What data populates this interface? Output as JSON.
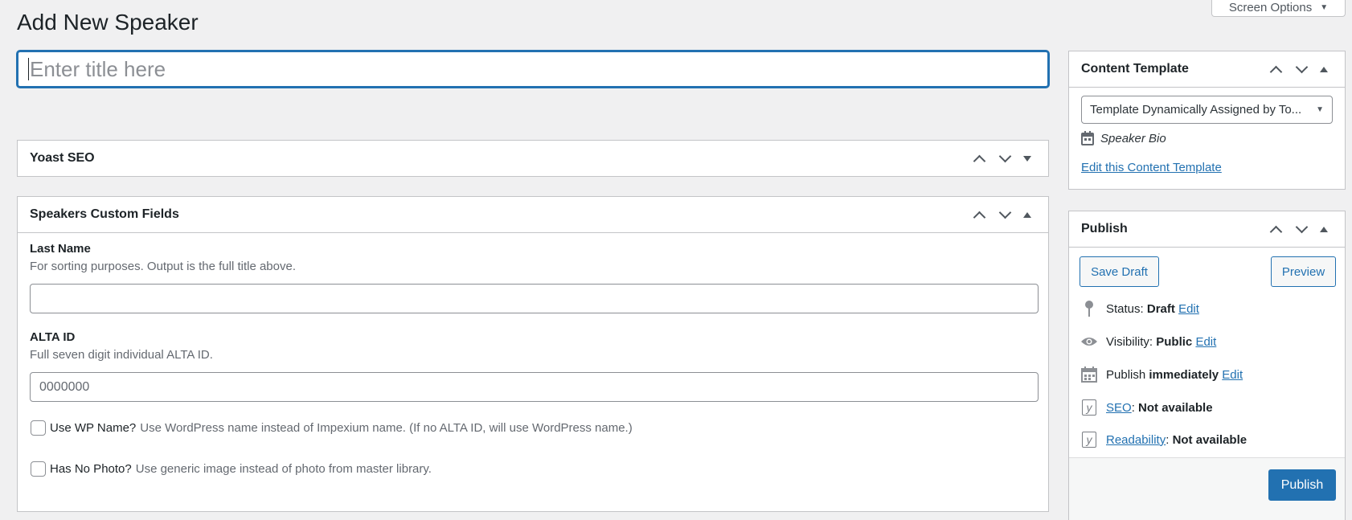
{
  "header": {
    "title": "Add New Speaker",
    "screen_options": "Screen Options"
  },
  "title_input": {
    "placeholder": "Enter title here"
  },
  "yoast_box": {
    "title": "Yoast SEO"
  },
  "custom_fields_box": {
    "title": "Speakers Custom Fields",
    "last_name": {
      "label": "Last Name",
      "description": "For sorting purposes. Output is the full title above.",
      "value": ""
    },
    "alta_id": {
      "label": "ALTA ID",
      "description": "Full seven digit individual ALTA ID.",
      "placeholder": "0000000"
    },
    "use_wp_name": {
      "label": "Use WP Name?",
      "description": "Use WordPress name instead of Impexium name. (If no ALTA ID, will use WordPress name.)"
    },
    "has_no_photo": {
      "label": "Has No Photo?",
      "description": "Use generic image instead of photo from master library."
    }
  },
  "content_template_box": {
    "title": "Content Template",
    "select_value": "Template Dynamically Assigned by To...",
    "template_name": "Speaker Bio",
    "edit_link": "Edit this Content Template"
  },
  "publish_box": {
    "title": "Publish",
    "save_draft": "Save Draft",
    "preview": "Preview",
    "status_label": "Status:",
    "status_value": "Draft",
    "visibility_label": "Visibility:",
    "visibility_value": "Public",
    "publish_label": "Publish",
    "publish_value": "immediately",
    "edit": "Edit",
    "seo_link": "SEO",
    "readability_link": "Readability",
    "not_available": "Not available",
    "publish_button": "Publish"
  }
}
